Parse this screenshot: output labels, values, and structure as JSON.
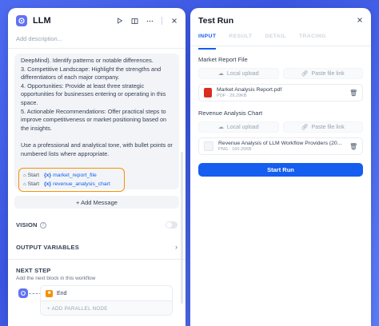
{
  "left": {
    "title": "LLM",
    "description_placeholder": "Add description...",
    "prompt_text": "DeepMind). Identify patterns or notable differences.\n3. Competitive Landscape: Highlight the strengths and differentiators of each major company.\n4. Opportunities: Provide at least three strategic opportunities for businesses entering or operating in this space.\n5. Actionable Recommendations: Offer practical steps to improve competitiveness or market positioning based on the insights.\n\nUse a professional and analytical tone, with bullet points or numbered lists where appropriate.",
    "variables": [
      {
        "source": "Start",
        "marker": "{x}",
        "name": "market_report_file"
      },
      {
        "source": "Start",
        "marker": "{x}",
        "name": "revenue_analysis_chart"
      }
    ],
    "add_message": "+ Add Message",
    "vision_label": "VISION",
    "output_variables_label": "OUTPUT VARIABLES",
    "next_step_label": "NEXT STEP",
    "next_step_sub": "Add the next block in this workflow",
    "end_label": "End",
    "add_parallel": "+ ADD PARALLEL NODE"
  },
  "right": {
    "title": "Test Run",
    "tabs": [
      "INPUT",
      "RESULT",
      "DETAIL",
      "TRACING"
    ],
    "field1_label": "Market Report File",
    "field2_label": "Revenue Analysis Chart",
    "local_upload": "Local upload",
    "paste_link": "Paste file link",
    "file1": {
      "name": "Market Analysis Report.pdf",
      "meta": "PDF · 29.29KB"
    },
    "file2": {
      "name": "Revenue Analysis of LLM Workflow Providers (20...",
      "meta": "PNG · 160.20KB"
    },
    "run_label": "Start Run"
  },
  "colors": {
    "accent": "#155eef",
    "highlight": "#f79009",
    "node": "#6172f3"
  }
}
